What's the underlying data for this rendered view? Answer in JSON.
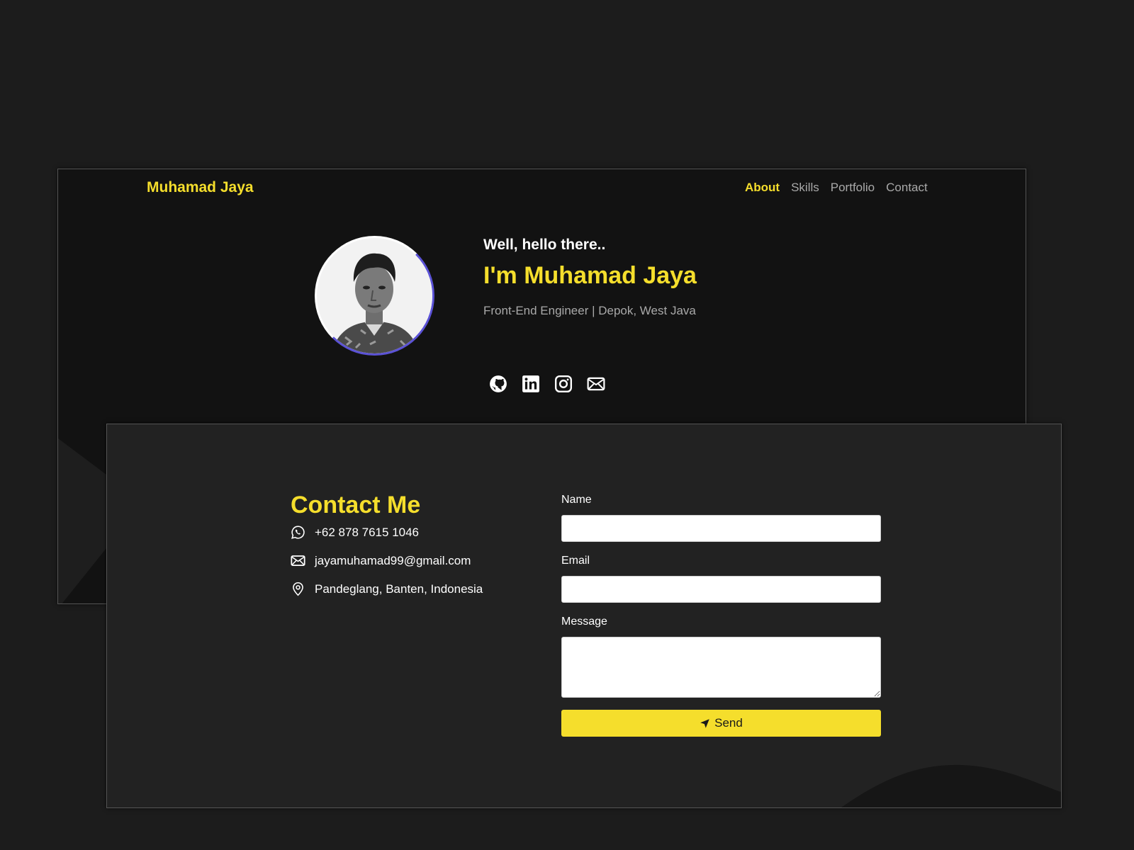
{
  "header": {
    "brand": "Muhamad Jaya",
    "nav": [
      "About",
      "Skills",
      "Portfolio",
      "Contact"
    ],
    "active_nav": "About"
  },
  "hero": {
    "greeting": "Well, hello there..",
    "headline": "I'm Muhamad Jaya",
    "subtitle": "Front-End Engineer | Depok, West Java",
    "avatar_icon": "profile-photo",
    "social_icons": [
      "github-icon",
      "linkedin-icon",
      "instagram-icon",
      "mail-icon"
    ]
  },
  "contact": {
    "title": "Contact Me",
    "phone": "+62 878 7615 1046",
    "email": "jayamuhamad99@gmail.com",
    "location": "Pandeglang, Banten, Indonesia",
    "icons": [
      "whatsapp-icon",
      "mail-icon",
      "location-pin-icon"
    ]
  },
  "form": {
    "name_label": "Name",
    "name_value": "",
    "email_label": "Email",
    "email_value": "",
    "message_label": "Message",
    "message_value": "",
    "send_label": "Send",
    "send_icon": "send-arrow-icon"
  },
  "colors": {
    "accent": "#f5de2c",
    "page_background": "#1c1c1c",
    "top_window": "#121212",
    "bottom_window": "#222222",
    "muted_text": "#a9a9a9",
    "avatar_ring": "#5b52d6"
  }
}
